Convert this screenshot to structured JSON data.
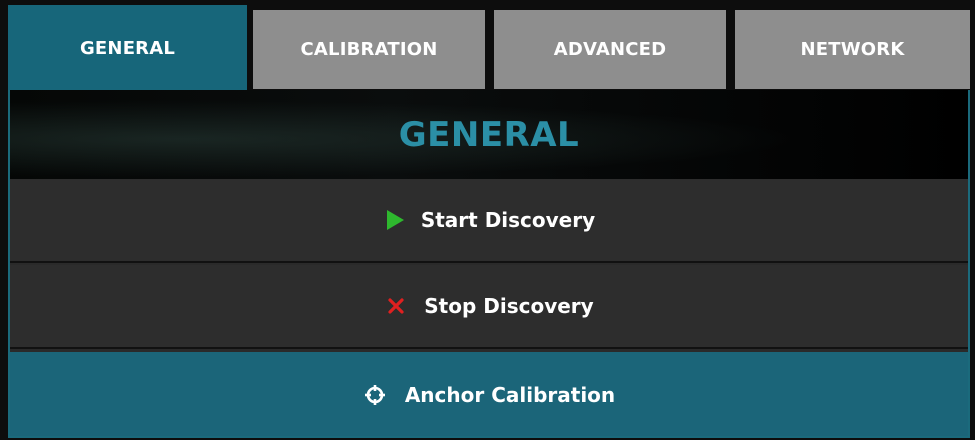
{
  "tabs": [
    {
      "label": "GENERAL",
      "active": true
    },
    {
      "label": "CALIBRATION",
      "active": false
    },
    {
      "label": "ADVANCED",
      "active": false
    },
    {
      "label": "NETWORK",
      "active": false
    }
  ],
  "panel": {
    "title": "GENERAL",
    "actions": [
      {
        "label": "Start Discovery",
        "icon": "play-icon",
        "icon_color": "#2eb82e"
      },
      {
        "label": "Stop Discovery",
        "icon": "close-icon",
        "icon_color": "#e02020"
      },
      {
        "label": "Anchor Calibration",
        "icon": "crosshair-icon",
        "icon_color": "#ffffff"
      }
    ]
  },
  "colors": {
    "accent": "#17667a",
    "title": "#2b8fa6",
    "inactive_tab": "#8e8e8e"
  }
}
